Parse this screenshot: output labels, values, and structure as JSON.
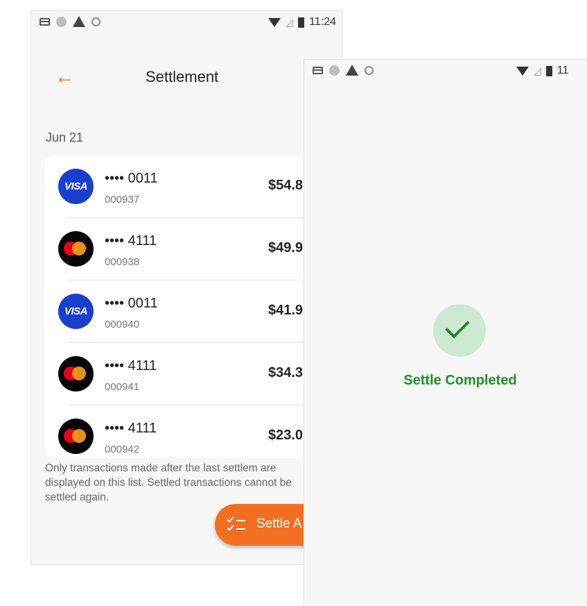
{
  "status_bar": {
    "time": "11:24",
    "time_partial": "11"
  },
  "settlement": {
    "title": "Settlement",
    "date_header": "Jun 21",
    "transactions": [
      {
        "card": "•••• 0011",
        "ref": "000937",
        "amount": "$54.8",
        "brand": "visa"
      },
      {
        "card": "•••• 4111",
        "ref": "000938",
        "amount": "$49.9",
        "brand": "mastercard"
      },
      {
        "card": "•••• 0011",
        "ref": "000940",
        "amount": "$41.9",
        "brand": "visa"
      },
      {
        "card": "•••• 4111",
        "ref": "000941",
        "amount": "$34.3",
        "brand": "mastercard"
      },
      {
        "card": "•••• 4111",
        "ref": "000942",
        "amount": "$23.0",
        "brand": "mastercard"
      }
    ],
    "visa_label": "VISA",
    "note": "Only transactions made after the last settlem are displayed on this list. Settled transactions cannot be settled again.",
    "settle_button_label": "Settle A"
  },
  "confirmation": {
    "message": "Settle Completed"
  },
  "colors": {
    "accent": "#f26f21",
    "success": "#1e8f2a",
    "visa": "#1a3fcf"
  }
}
